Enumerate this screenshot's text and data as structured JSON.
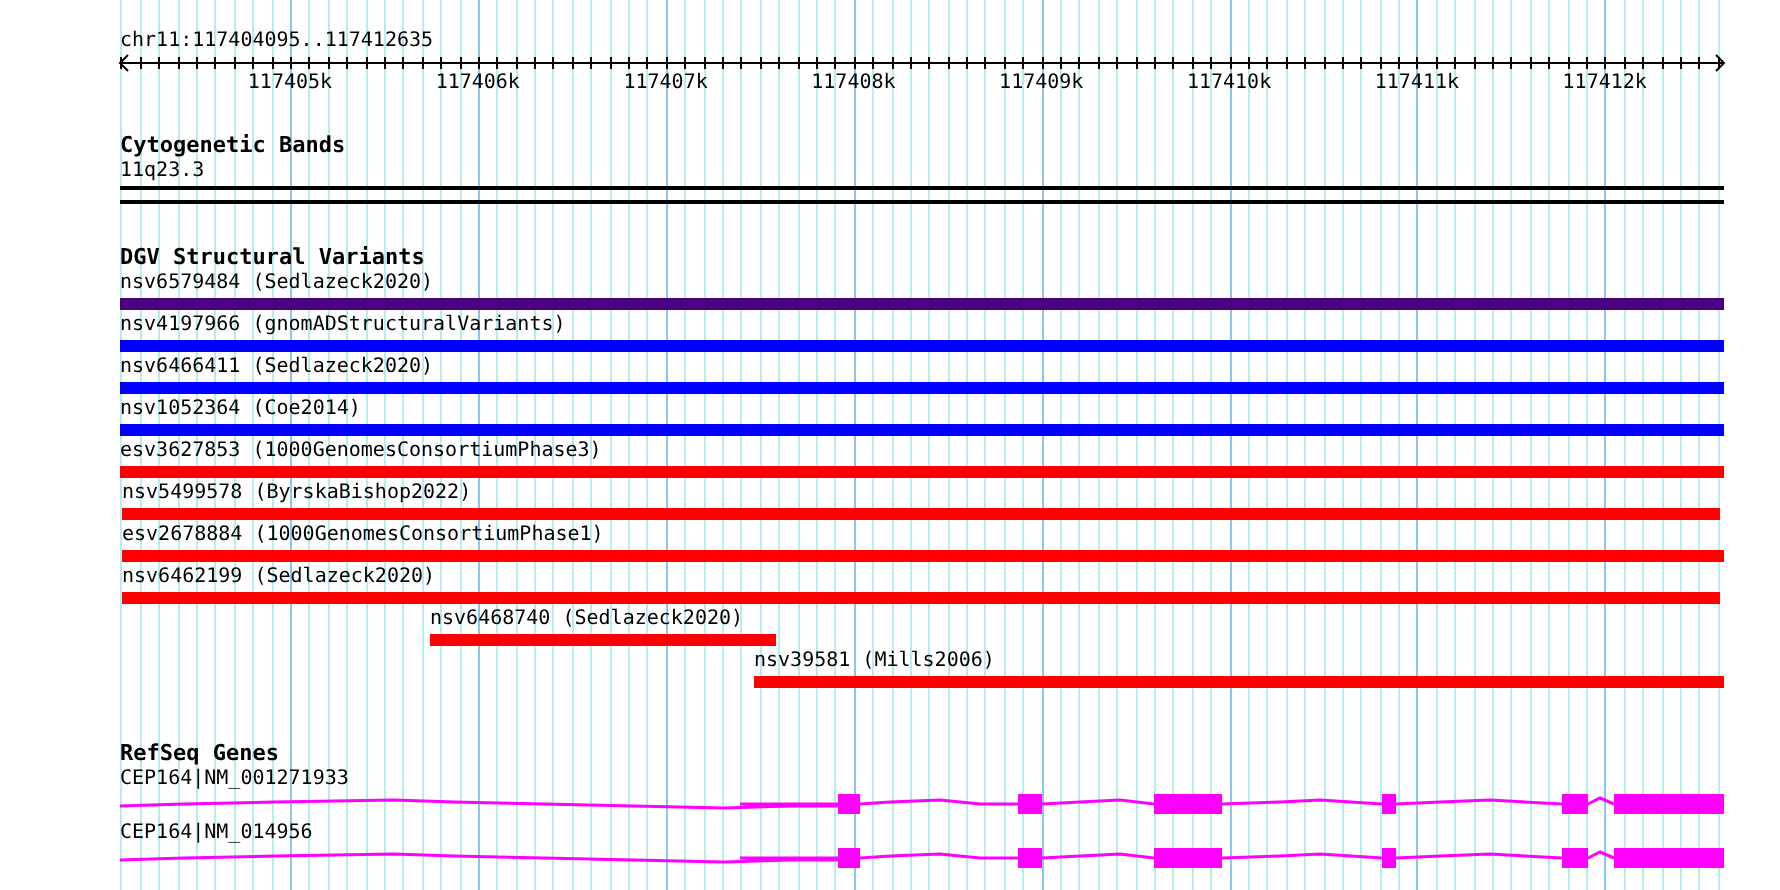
{
  "location": "chr11:117404095..117412635",
  "ruler": {
    "ticks": [
      "117405k",
      "117406k",
      "117407k",
      "117408k",
      "117409k",
      "117410k",
      "117411k",
      "117412k"
    ]
  },
  "tracks": [
    {
      "title": "Cytogenetic Bands",
      "kind": "cytoband",
      "features": [
        {
          "label": "11q23.3"
        }
      ]
    },
    {
      "title": "DGV Structural Variants",
      "kind": "variant",
      "features": [
        {
          "label": "nsv6579484 (Sedlazeck2020)",
          "color": "#4b0082"
        },
        {
          "label": "nsv4197966 (gnomADStructuralVariants)",
          "color": "#0000ff"
        },
        {
          "label": "nsv6466411 (Sedlazeck2020)",
          "color": "#0000ff"
        },
        {
          "label": "nsv1052364 (Coe2014)",
          "color": "#0000ff"
        },
        {
          "label": "esv3627853 (1000GenomesConsortiumPhase3)",
          "color": "#ff0000"
        },
        {
          "label": "nsv5499578 (ByrskaBishop2022)",
          "color": "#ff0000"
        },
        {
          "label": "esv2678884 (1000GenomesConsortiumPhase1)",
          "color": "#ff0000"
        },
        {
          "label": "nsv6462199 (Sedlazeck2020)",
          "color": "#ff0000"
        },
        {
          "label": "nsv6468740 (Sedlazeck2020)",
          "color": "#ff0000"
        },
        {
          "label": "nsv39581 (Mills2006)",
          "color": "#ff0000"
        }
      ]
    },
    {
      "title": "RefSeq Genes",
      "kind": "gene",
      "features": [
        {
          "label": "CEP164|NM_001271933"
        },
        {
          "label": "CEP164|NM_014956"
        }
      ]
    }
  ]
}
